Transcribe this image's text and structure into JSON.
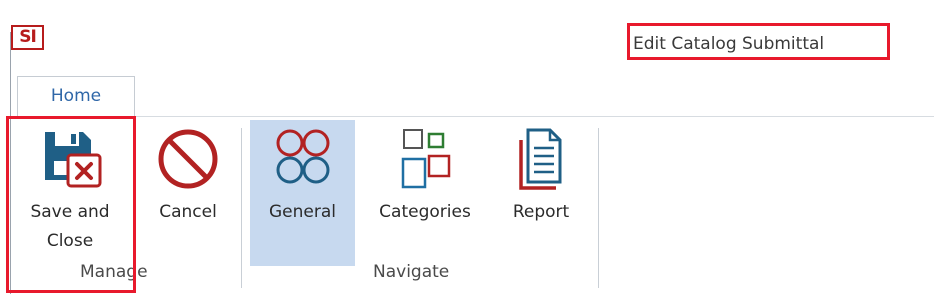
{
  "app": {
    "logo_text": "SI"
  },
  "window": {
    "title": "Edit Catalog Submittal"
  },
  "tabs": [
    {
      "label": "Home"
    }
  ],
  "ribbon": {
    "buttons": {
      "save_close": {
        "label": "Save and Close"
      },
      "cancel": {
        "label": "Cancel"
      },
      "general": {
        "label": "General",
        "selected": true
      },
      "categories": {
        "label": "Categories"
      },
      "report": {
        "label": "Report"
      }
    },
    "groups": {
      "manage": {
        "label": "Manage"
      },
      "navigate": {
        "label": "Navigate"
      }
    }
  },
  "colors": {
    "accent_blue": "#1f5f86",
    "accent_red": "#b22222",
    "highlight_box": "#e8192c",
    "selected_bg": "#c7d9ef"
  }
}
